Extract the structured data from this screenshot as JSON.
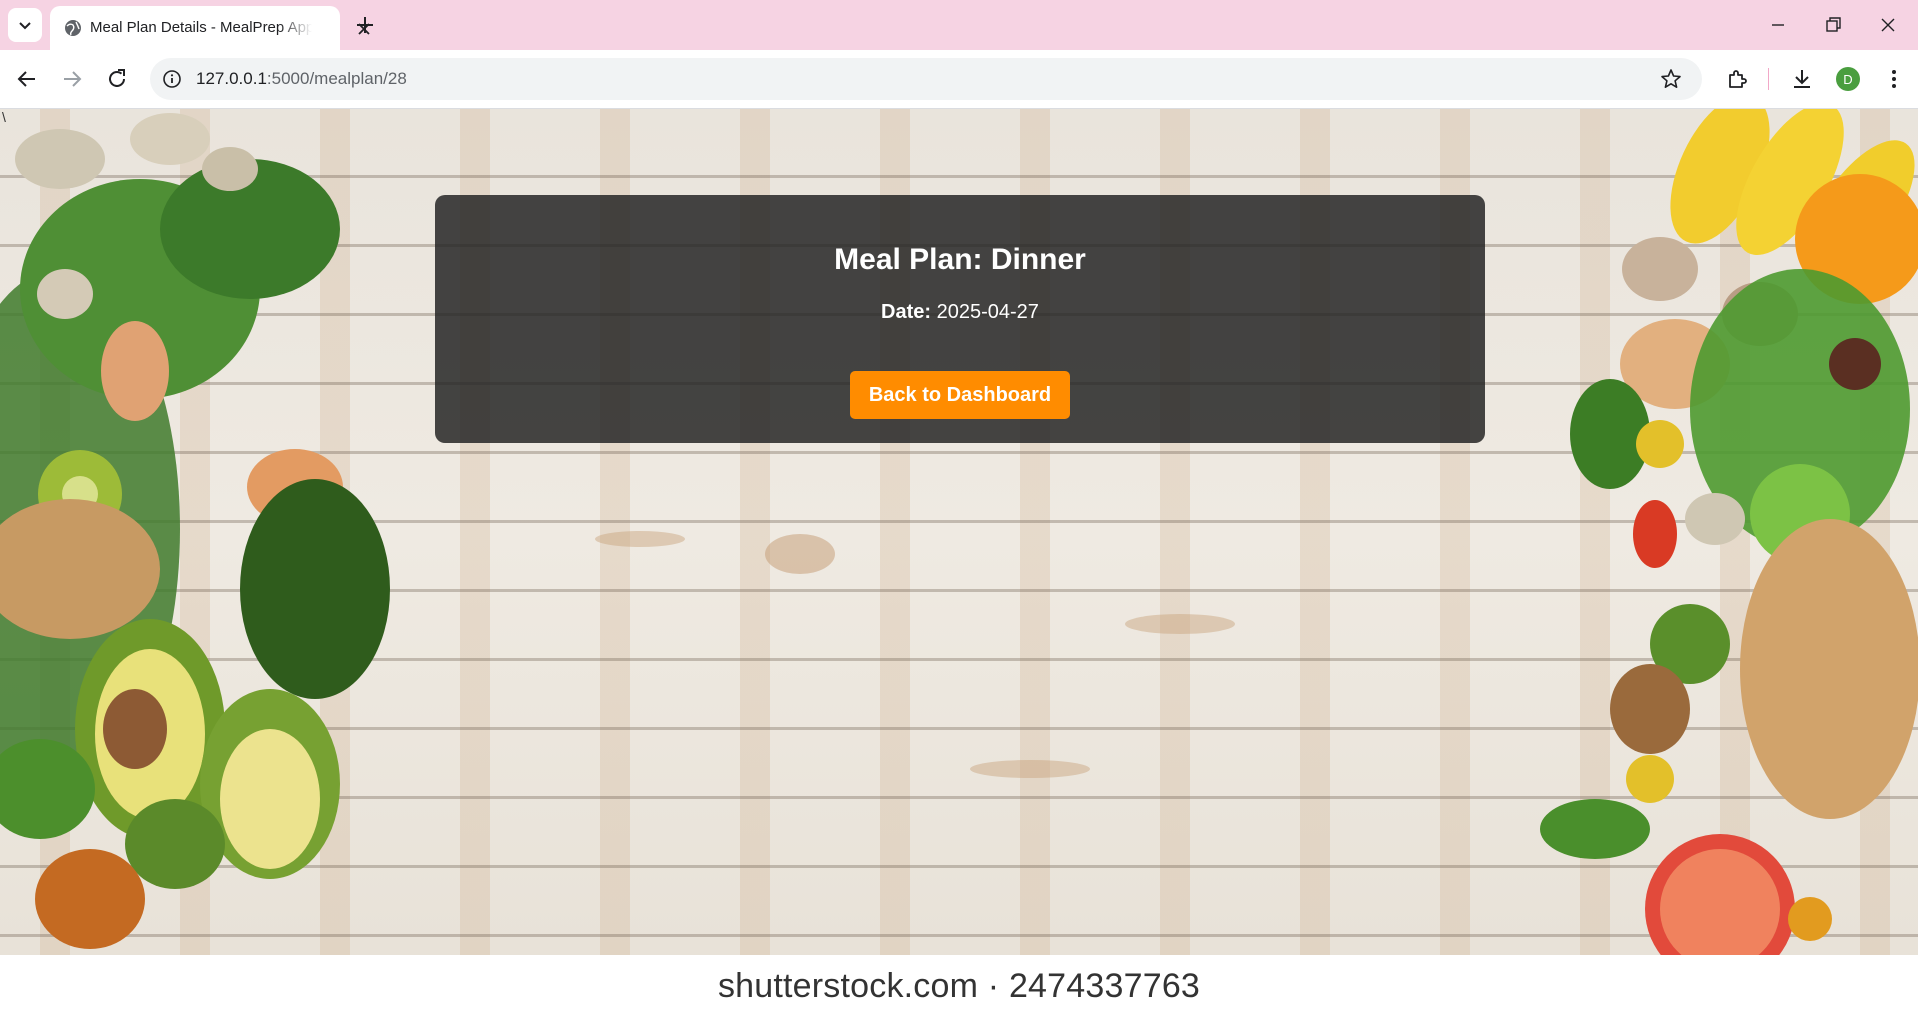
{
  "browser": {
    "tab_title": "Meal Plan Details - MealPrep App",
    "url_host": "127.0.0.1",
    "url_rest": ":5000/mealplan/28",
    "profile_initial": "D"
  },
  "page": {
    "title": "Meal Plan: Dinner",
    "date_label": "Date:",
    "date_value": "2025-04-27",
    "back_button": "Back to Dashboard",
    "stray_char": "\\",
    "watermark": "shutterstock.com · 2474337763"
  },
  "colors": {
    "accent": "#ff8c00",
    "card_bg": "rgba(34,34,34,0.84)",
    "tabbar_bg": "#f6d3e3"
  }
}
